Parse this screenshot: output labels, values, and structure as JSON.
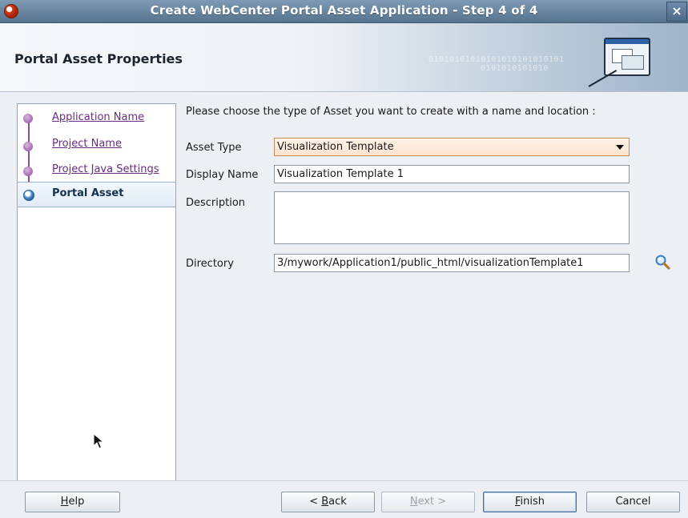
{
  "window": {
    "title": "Create WebCenter Portal Asset Application - Step 4 of 4",
    "close_glyph": "×",
    "icon": "oracle-app-icon"
  },
  "header": {
    "title": "Portal Asset Properties",
    "binary_line_1": "01010101010101010101010101",
    "binary_line_2": "0101010101010",
    "icon": "wizard-icon"
  },
  "steps": [
    {
      "label": "Application Name",
      "current": false
    },
    {
      "label": "Project Name",
      "current": false
    },
    {
      "label": "Project Java Settings",
      "current": false
    },
    {
      "label": "Portal Asset",
      "current": true
    }
  ],
  "form": {
    "prompt": "Please choose the type of Asset you want to create with a name and location :",
    "asset_type_label": "Asset Type",
    "asset_type_value": "Visualization Template",
    "display_name_label": "Display Name",
    "display_name_value": "Visualization Template 1",
    "description_label": "Description",
    "description_value": "",
    "directory_label": "Directory",
    "directory_value": "3/mywork/Application1/public_html/visualizationTemplate1",
    "browse_icon": "magnifier-icon"
  },
  "buttons": {
    "help": {
      "mnemonic": "H",
      "rest": "elp"
    },
    "back": {
      "prefix": "< ",
      "mnemonic": "B",
      "rest": "ack"
    },
    "next": {
      "mnemonic": "N",
      "rest": "ext >"
    },
    "finish": {
      "mnemonic": "F",
      "rest": "inish"
    },
    "cancel": {
      "label": "Cancel"
    }
  }
}
